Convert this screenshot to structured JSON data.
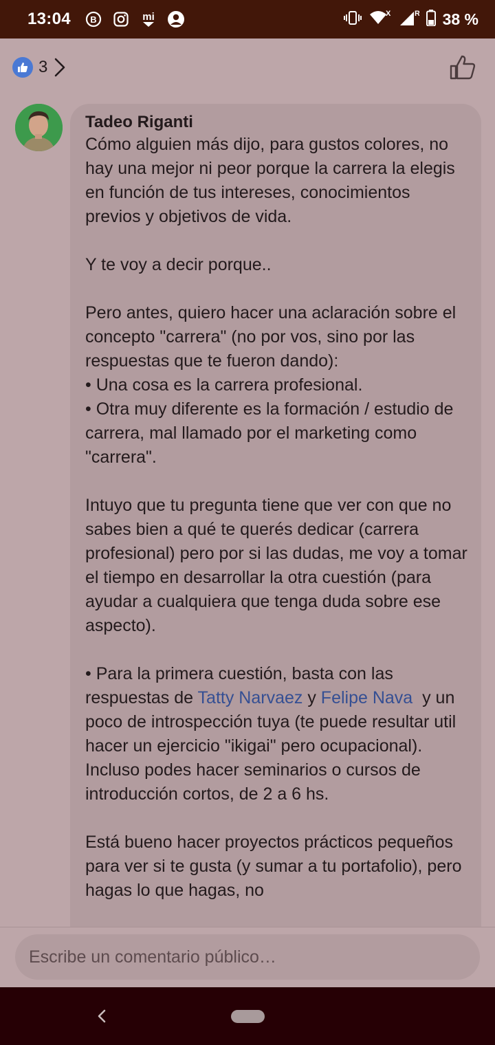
{
  "status_bar": {
    "time": "13:04",
    "battery_percent": "38 %",
    "icons": [
      "b-badge-icon",
      "instagram-icon",
      "mi-icon",
      "profile-circle-icon",
      "vibrate-icon",
      "wifi-icon",
      "signal-icon",
      "battery-icon"
    ]
  },
  "reactions": {
    "count": "3",
    "icon": "thumbs-up-icon"
  },
  "comment": {
    "author": "Tadeo Riganti",
    "paragraphs": [
      "Cómo alguien más dijo, para gustos colores, no hay una mejor ni peor porque la carrera la elegis en función de tus intereses, conocimientos previos y objetivos de vida.",
      "Y te voy a decir porque..",
      "Pero antes, quiero hacer una aclaración sobre el concepto \"carrera\" (no por vos, sino por las respuestas que te fueron dando):",
      "• Una cosa es la carrera profesional.",
      "• Otra muy diferente es la formación / estudio de carrera, mal llamado por el marketing como \"carrera\".",
      "Intuyo que tu pregunta tiene que ver con que no sabes bien a qué te querés dedicar (carrera profesional) pero por si las dudas, me voy a tomar el tiempo en desarrollar la otra cuestión (para ayudar a cualquiera que tenga duda sobre ese aspecto).",
      "• Para la primera cuestión, basta con las respuestas de",
      "Tatty Narvaez",
      "y",
      "Felipe Nava",
      "y un poco de introspección tuya (te puede resultar util hacer un ejercicio \"ikigai\" pero ocupacional).",
      "Incluso podes hacer seminarios o cursos de introducción cortos, de 2 a 6 hs.",
      "Está bueno hacer proyectos prácticos pequeños para ver si te gusta (y sumar a tu portafolio), pero hagas lo que hagas, no"
    ]
  },
  "input": {
    "placeholder": "Escribe un comentario público…"
  },
  "colors": {
    "background": "#bda6a9",
    "bubble": "#b29c9f",
    "status_bar": "#421709",
    "nav_bar": "#260005",
    "mention": "#354f93",
    "like_badge": "#4a79d4"
  }
}
